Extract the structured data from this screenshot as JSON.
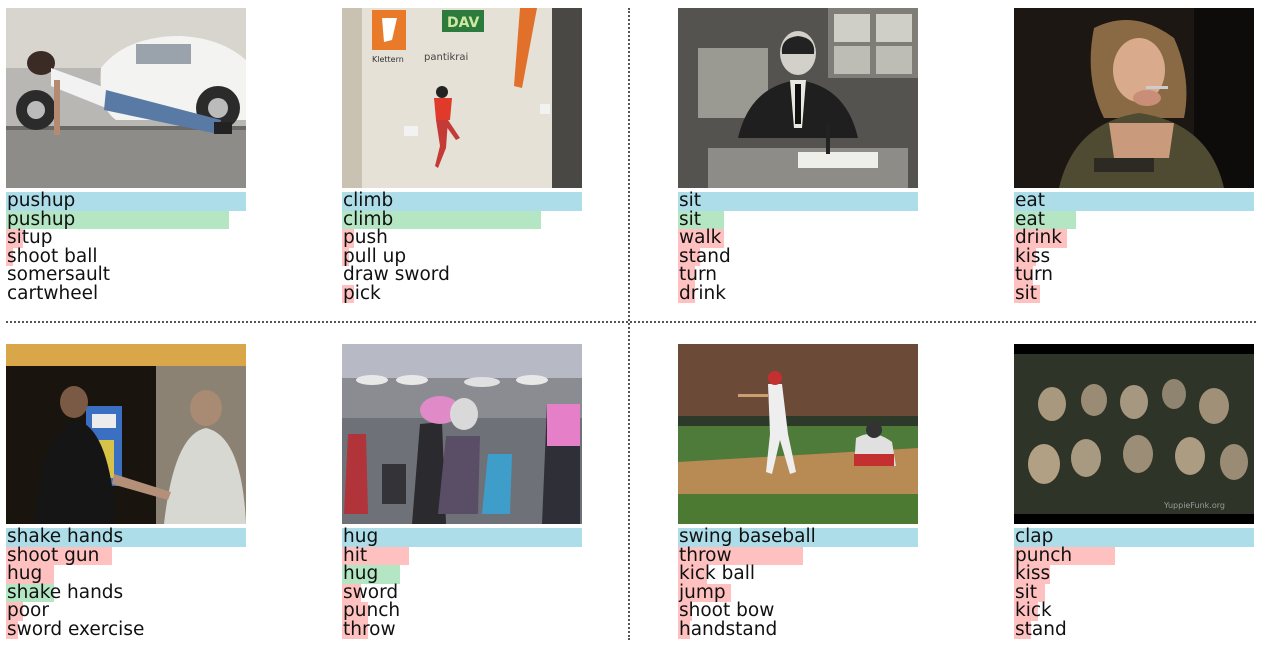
{
  "colors": {
    "truth": "#ADDDE9",
    "correct": "#B4E6C4",
    "wrong": "#FFC0C0"
  },
  "examples": [
    {
      "truth": "pushup",
      "preds": [
        {
          "label": "pushup",
          "score": 0.93,
          "kind": "correct"
        },
        {
          "label": "situp",
          "score": 0.07,
          "kind": "wrong"
        },
        {
          "label": "shoot ball",
          "score": 0.03,
          "kind": "wrong"
        },
        {
          "label": "somersault",
          "score": 0.0,
          "kind": "wrong"
        },
        {
          "label": "cartwheel",
          "score": 0.0,
          "kind": "wrong"
        }
      ]
    },
    {
      "truth": "climb",
      "preds": [
        {
          "label": "climb",
          "score": 0.83,
          "kind": "correct"
        },
        {
          "label": "push",
          "score": 0.05,
          "kind": "wrong"
        },
        {
          "label": "pull up",
          "score": 0.03,
          "kind": "wrong"
        },
        {
          "label": "draw sword",
          "score": 0.0,
          "kind": "wrong"
        },
        {
          "label": "pick",
          "score": 0.05,
          "kind": "wrong"
        }
      ]
    },
    {
      "truth": "sit",
      "preds": [
        {
          "label": "sit",
          "score": 0.19,
          "kind": "correct"
        },
        {
          "label": "walk",
          "score": 0.19,
          "kind": "wrong"
        },
        {
          "label": "stand",
          "score": 0.09,
          "kind": "wrong"
        },
        {
          "label": "turn",
          "score": 0.07,
          "kind": "wrong"
        },
        {
          "label": "drink",
          "score": 0.07,
          "kind": "wrong"
        }
      ]
    },
    {
      "truth": "eat",
      "preds": [
        {
          "label": "eat",
          "score": 0.26,
          "kind": "correct"
        },
        {
          "label": "drink",
          "score": 0.22,
          "kind": "wrong"
        },
        {
          "label": "kiss",
          "score": 0.09,
          "kind": "wrong"
        },
        {
          "label": "turn",
          "score": 0.08,
          "kind": "wrong"
        },
        {
          "label": "sit",
          "score": 0.11,
          "kind": "wrong"
        }
      ]
    },
    {
      "truth": "shake hands",
      "preds": [
        {
          "label": "shoot gun",
          "score": 0.44,
          "kind": "wrong"
        },
        {
          "label": "hug",
          "score": 0.2,
          "kind": "wrong"
        },
        {
          "label": "shake hands",
          "score": 0.2,
          "kind": "correct"
        },
        {
          "label": "poor",
          "score": 0.07,
          "kind": "wrong"
        },
        {
          "label": "sword exercise",
          "score": 0.05,
          "kind": "wrong"
        }
      ]
    },
    {
      "truth": "hug",
      "preds": [
        {
          "label": "hit",
          "score": 0.28,
          "kind": "wrong"
        },
        {
          "label": "hug",
          "score": 0.24,
          "kind": "correct"
        },
        {
          "label": "sword",
          "score": 0.08,
          "kind": "wrong"
        },
        {
          "label": "punch",
          "score": 0.11,
          "kind": "wrong"
        },
        {
          "label": "throw",
          "score": 0.11,
          "kind": "wrong"
        }
      ]
    },
    {
      "truth": "swing baseball",
      "preds": [
        {
          "label": "throw",
          "score": 0.52,
          "kind": "wrong"
        },
        {
          "label": "kick ball",
          "score": 0.12,
          "kind": "wrong"
        },
        {
          "label": "jump",
          "score": 0.22,
          "kind": "wrong"
        },
        {
          "label": "shoot bow",
          "score": 0.06,
          "kind": "wrong"
        },
        {
          "label": "handstand",
          "score": 0.05,
          "kind": "wrong"
        }
      ]
    },
    {
      "truth": "clap",
      "preds": [
        {
          "label": "punch",
          "score": 0.42,
          "kind": "wrong"
        },
        {
          "label": "kiss",
          "score": 0.15,
          "kind": "wrong"
        },
        {
          "label": "sit",
          "score": 0.13,
          "kind": "wrong"
        },
        {
          "label": "kick",
          "score": 0.1,
          "kind": "wrong"
        },
        {
          "label": "stand",
          "score": 0.07,
          "kind": "wrong"
        }
      ]
    }
  ],
  "watermark": "YuppieFunk.org"
}
